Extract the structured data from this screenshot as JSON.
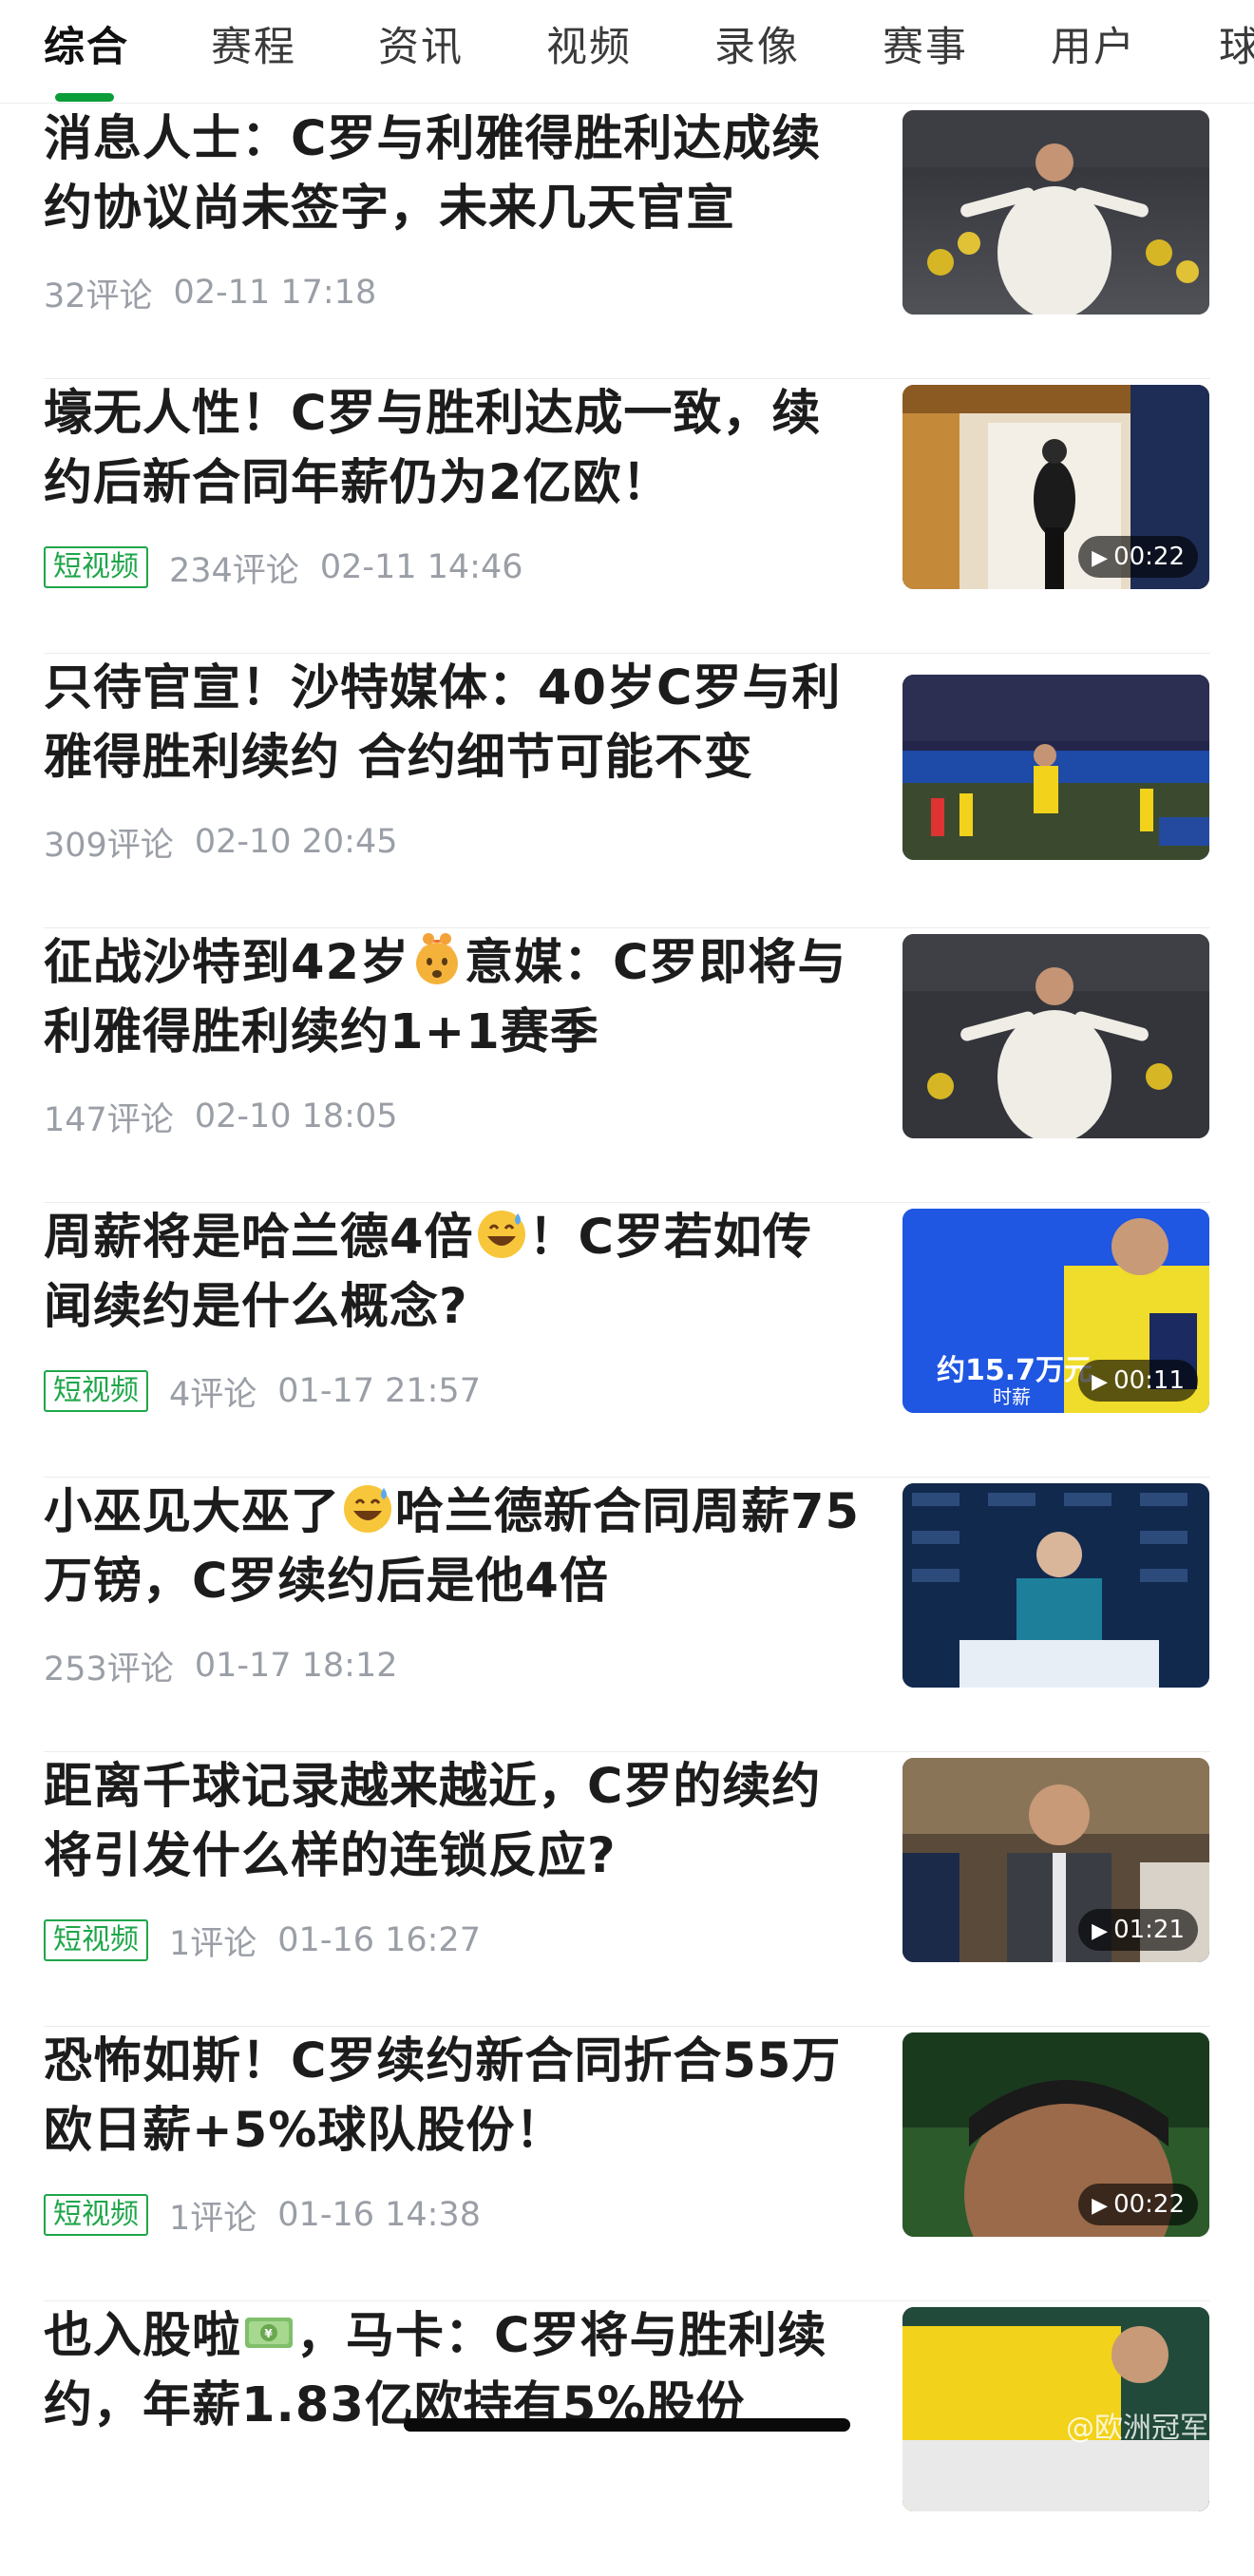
{
  "tabs": [
    {
      "label": "综合"
    },
    {
      "label": "赛程"
    },
    {
      "label": "资讯"
    },
    {
      "label": "视频"
    },
    {
      "label": "录像"
    },
    {
      "label": "赛事"
    },
    {
      "label": "用户"
    },
    {
      "label": "球"
    }
  ],
  "active_tab": "综合",
  "accent_color": "#0a9d3a",
  "feed": [
    {
      "title": "消息人士：C罗与利雅得胜利达成续约协议尚未签字，未来几天官宣",
      "badge": "",
      "comments": "32评论",
      "time": "02-11 17:18",
      "duration": ""
    },
    {
      "title": "壕无人性！C罗与胜利达成一致，续约后新合同年薪仍为2亿欧！",
      "badge": "短视频",
      "comments": "234评论",
      "time": "02-11 14:46",
      "duration": "00:22"
    },
    {
      "title": "只待官宣！沙特媒体：40岁C罗与利雅得胜利续约 合约细节可能不变",
      "badge": "",
      "comments": "309评论",
      "time": "02-10 20:45",
      "duration": ""
    },
    {
      "title_a": "征战沙特到42岁",
      "emoji": "exploding-head",
      "title_b": "意媒：C罗即将与利雅得胜利续约1+1赛季",
      "badge": "",
      "comments": "147评论",
      "time": "02-10 18:05",
      "duration": ""
    },
    {
      "title_a": "周薪将是哈兰德4倍",
      "emoji": "grinning-sweat",
      "title_b": "！C罗若如传闻续约是什么概念?",
      "badge": "短视频",
      "comments": "4评论",
      "time": "01-17 21:57",
      "duration": "00:11",
      "thumb_text": "约15.7万元",
      "thumb_sub": "时薪"
    },
    {
      "title_a": "小巫见大巫了",
      "emoji": "grinning-sweat",
      "title_b": "哈兰德新合同周薪75万镑，C罗续约后是他4倍",
      "badge": "",
      "comments": "253评论",
      "time": "01-17 18:12",
      "duration": ""
    },
    {
      "title": "距离千球记录越来越近，C罗的续约将引发什么样的连锁反应?",
      "badge": "短视频",
      "comments": "1评论",
      "time": "01-16 16:27",
      "duration": "01:21"
    },
    {
      "title": "恐怖如斯！C罗续约新合同折合55万欧日薪+5%球队股份！",
      "badge": "短视频",
      "comments": "1评论",
      "time": "01-16 14:38",
      "duration": "00:22"
    },
    {
      "title_a": "也入股啦",
      "emoji": "money-bag",
      "title_b": "，马卡：C罗将与胜利续约，年薪1.83亿欧持有5%股份",
      "badge": "",
      "comments": "",
      "time": "",
      "duration": ""
    }
  ],
  "watermark": "@欧洲冠军杯"
}
